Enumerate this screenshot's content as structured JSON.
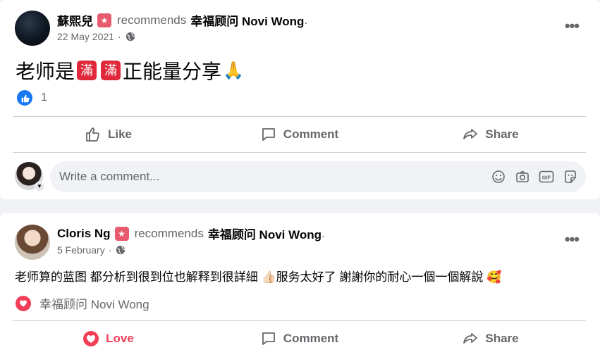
{
  "post1": {
    "author": "蘇熙兒",
    "recommends": "recommends",
    "page": "幸福顾问 Novi Wong",
    "period": ".",
    "date": "22 May 2021",
    "meta_sep": "·",
    "text_before": "老师是",
    "man1": "滿",
    "man2": "滿",
    "text_after": "正能量分享",
    "emoji": "🙏",
    "like_count": "1",
    "actions": {
      "like": "Like",
      "comment": "Comment",
      "share": "Share"
    },
    "composer_placeholder": "Write a comment...",
    "composer_tools": [
      "emoji-icon",
      "camera-icon",
      "gif-icon",
      "sticker-icon"
    ]
  },
  "post2": {
    "author": "Cloris Ng",
    "recommends": "recommends",
    "page": "幸福顾问 Novi Wong",
    "period": ".",
    "date": "5 February",
    "meta_sep": "·",
    "text": "老师算的蓝图 都分析到很到位也解释到很詳細 👍🏻服务太好了 謝謝你的耐心一個一個解說 🥰",
    "page_reaction": "幸福顾问 Novi Wong",
    "actions": {
      "love": "Love",
      "comment": "Comment",
      "share": "Share"
    }
  },
  "colors": {
    "fb_blue": "#1877f2",
    "love_red": "#f33e58",
    "secondary_text": "#65676b"
  }
}
